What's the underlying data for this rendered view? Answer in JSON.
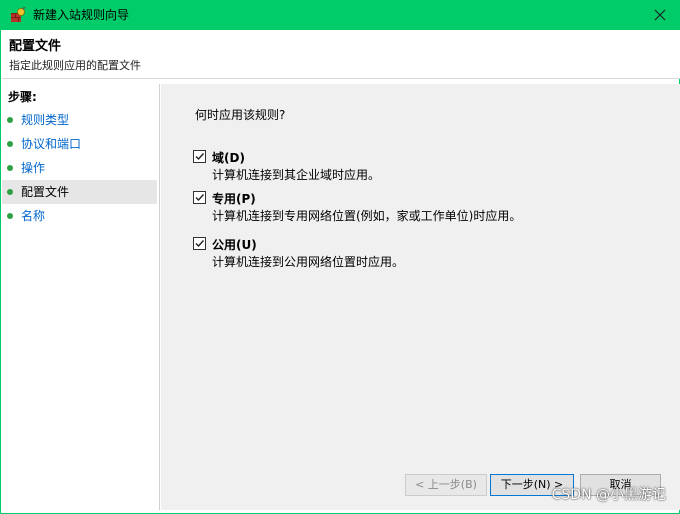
{
  "window": {
    "title": "新建入站规则向导",
    "accent_color": "#00cc6a",
    "close_icon": "close-icon"
  },
  "header": {
    "title": "配置文件",
    "subtitle": "指定此规则应用的配置文件"
  },
  "sidebar": {
    "title": "步骤:",
    "items": [
      {
        "label": "规则类型",
        "current": false
      },
      {
        "label": "协议和端口",
        "current": false
      },
      {
        "label": "操作",
        "current": false
      },
      {
        "label": "配置文件",
        "current": true
      },
      {
        "label": "名称",
        "current": false
      }
    ]
  },
  "main": {
    "question": "何时应用该规则?",
    "options": [
      {
        "label": "域(D)",
        "desc": "计算机连接到其企业域时应用。",
        "checked": true
      },
      {
        "label": "专用(P)",
        "desc": "计算机连接到专用网络位置(例如，家或工作单位)时应用。",
        "checked": true
      },
      {
        "label": "公用(U)",
        "desc": "计算机连接到公用网络位置时应用。",
        "checked": true
      }
    ]
  },
  "buttons": {
    "back": "< 上一步(B)",
    "next": "下一步(N) >",
    "cancel": "取消"
  },
  "watermark": "CSDN @小黑游记"
}
